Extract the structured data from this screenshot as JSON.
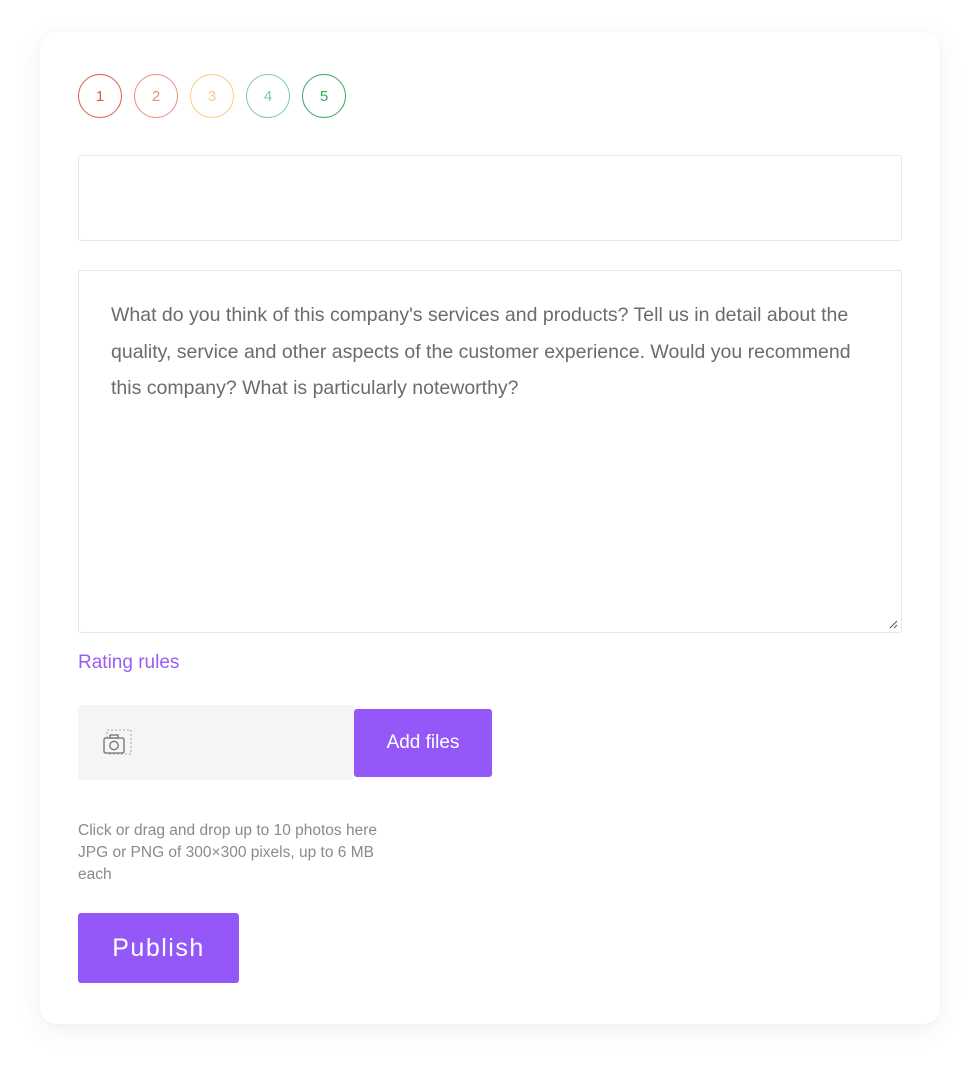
{
  "rating": {
    "options": [
      {
        "label": "1",
        "color": "#e1574c"
      },
      {
        "label": "2",
        "color": "#ee8a7f"
      },
      {
        "label": "3",
        "color": "#f3cf7a"
      },
      {
        "label": "4",
        "color": "#7dcc96"
      },
      {
        "label": "5",
        "color": "#35a95c"
      }
    ]
  },
  "title_input": {
    "value": "",
    "placeholder": ""
  },
  "review": {
    "placeholder": "What do you think of this company's services and products? Tell us in detail about the quality, service and other aspects of the customer experience. Would you recommend this company? What is particularly noteworthy?"
  },
  "rules_link": "Rating rules",
  "upload": {
    "icon": "camera-icon",
    "button_label": "Add files",
    "hint_line1": "Click or drag and drop up to 10 photos here",
    "hint_line2": "JPG or PNG of 300×300 pixels, up to 6 MB",
    "hint_line3": "each"
  },
  "publish_label": "Publish",
  "colors": {
    "accent": "#9458f8",
    "link": "#9b5cf6"
  }
}
